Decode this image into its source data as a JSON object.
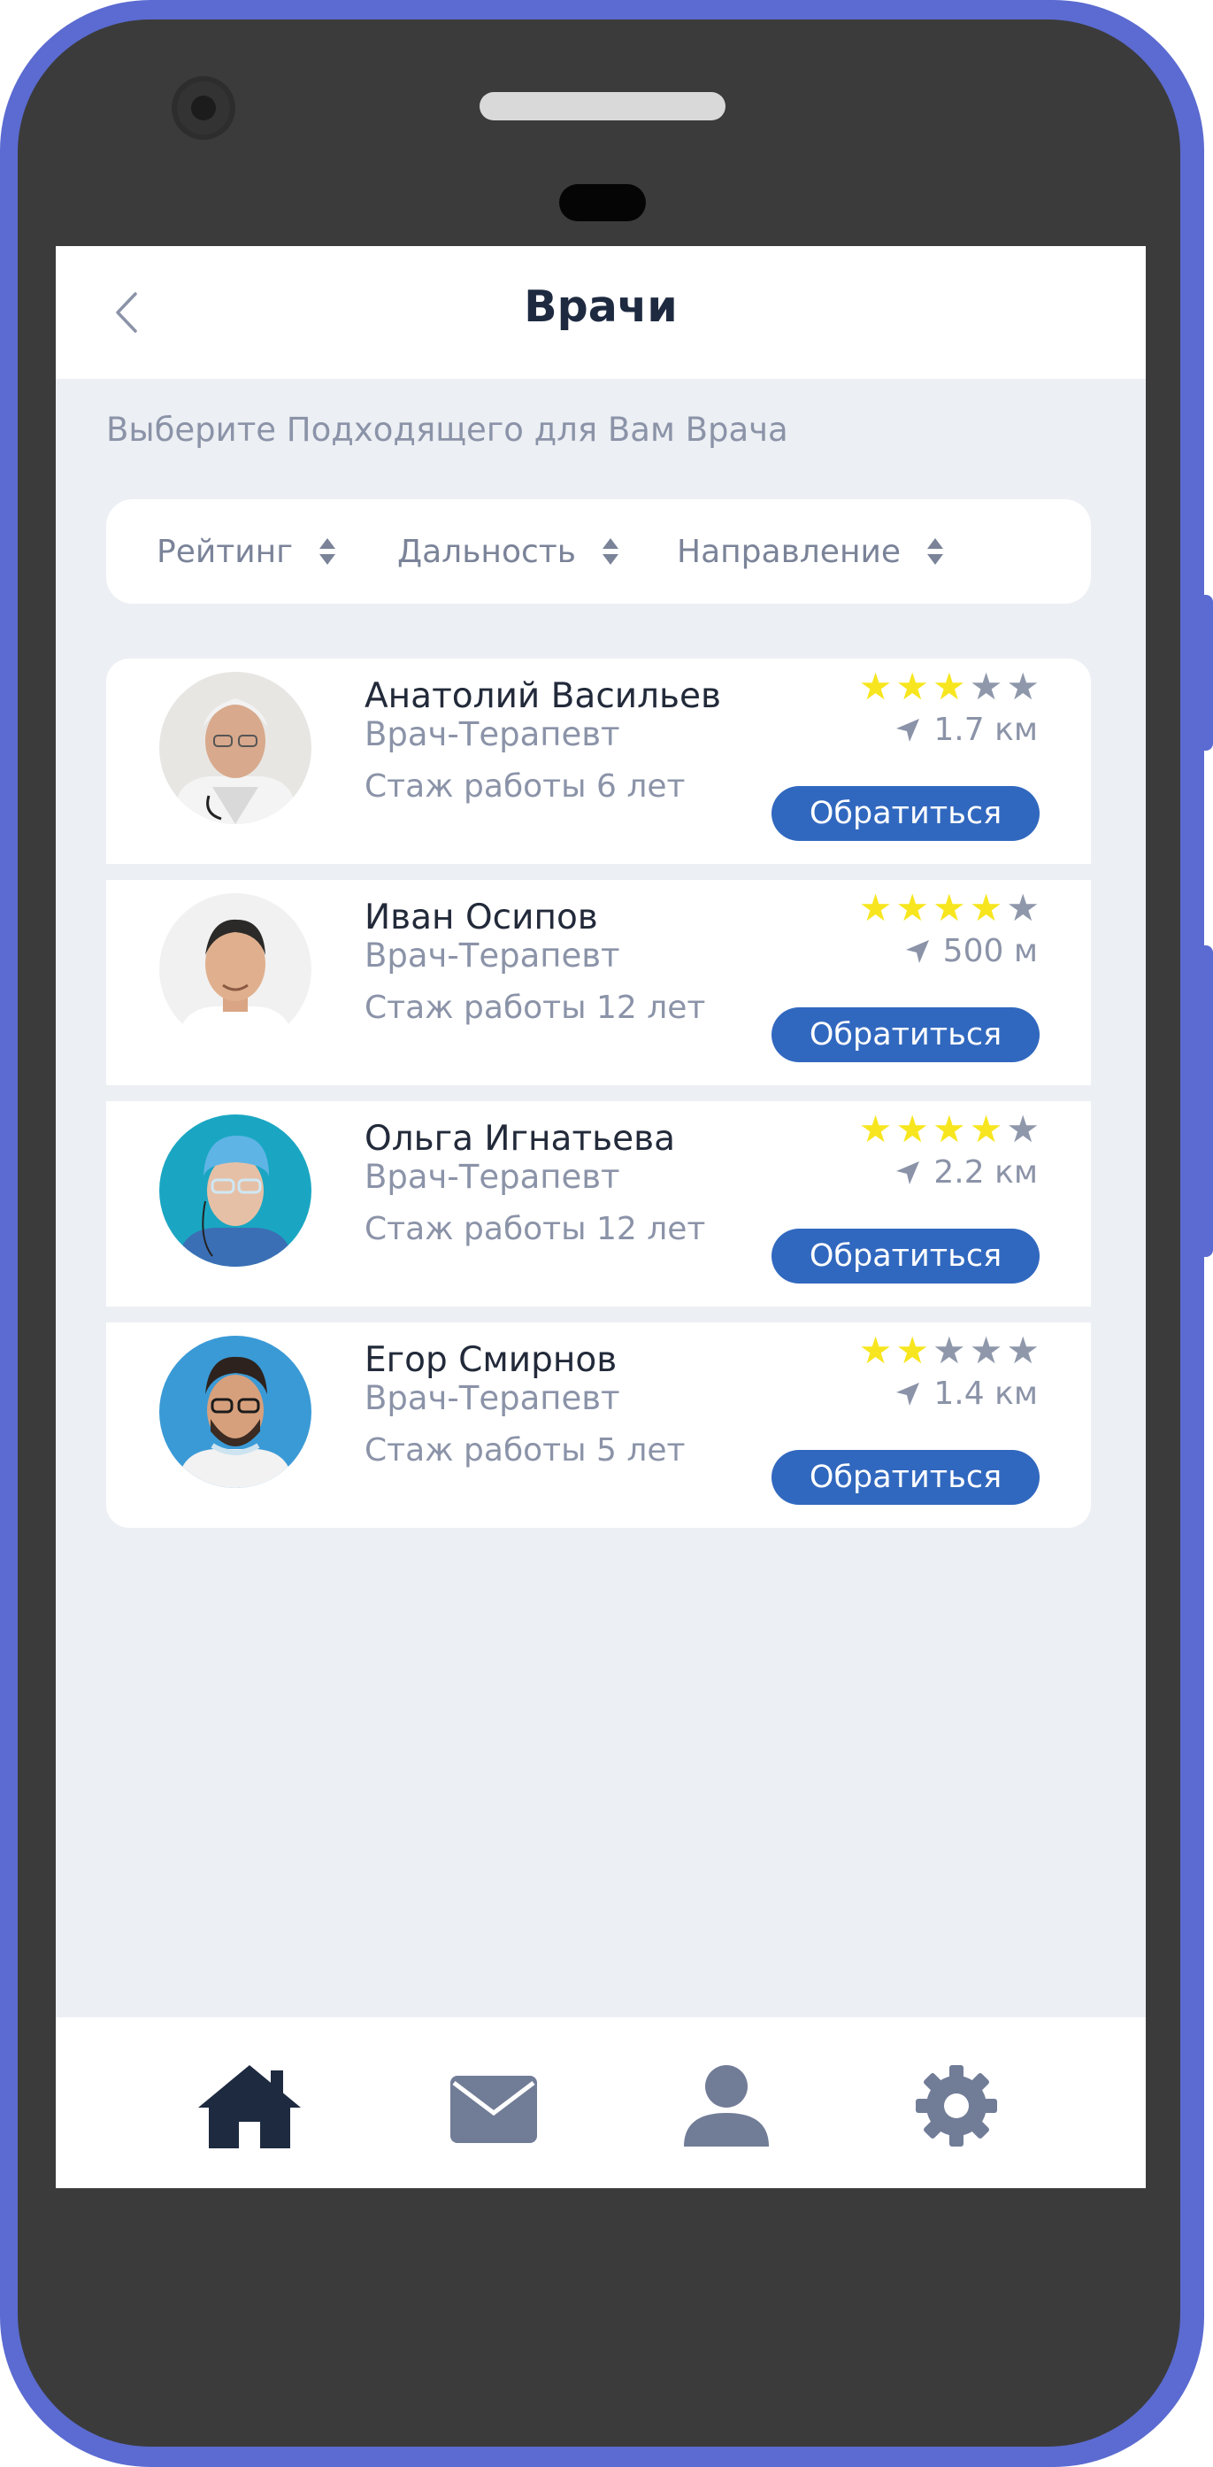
{
  "header": {
    "title": "Врачи"
  },
  "subtitle": "Выберите Подходящего для Вам Врача",
  "filters": [
    {
      "label": "Рейтинг"
    },
    {
      "label": "Дальность"
    },
    {
      "label": "Направление"
    }
  ],
  "doctors": [
    {
      "name": "Анатолий Васильев",
      "specialty": "Врач-Терапевт",
      "experience": "Стаж работы 6 лет",
      "rating": 3,
      "max_rating": 5,
      "distance": "1.7 км",
      "button": "Обратиться"
    },
    {
      "name": "Иван Осипов",
      "specialty": "Врач-Терапевт",
      "experience": "Стаж работы 12 лет",
      "rating": 4,
      "max_rating": 5,
      "distance": "500 м",
      "button": "Обратиться"
    },
    {
      "name": "Ольга Игнатьева",
      "specialty": "Врач-Терапевт",
      "experience": "Стаж работы 12 лет",
      "rating": 4,
      "max_rating": 5,
      "distance": "2.2 км",
      "button": "Обратиться"
    },
    {
      "name": "Егор Смирнов",
      "specialty": "Врач-Терапевт",
      "experience": "Стаж работы 5 лет",
      "rating": 2,
      "max_rating": 5,
      "distance": "1.4 км",
      "button": "Обратиться"
    }
  ],
  "bottom_nav": [
    {
      "icon": "home-icon",
      "active": true
    },
    {
      "icon": "mail-icon",
      "active": false
    },
    {
      "icon": "user-icon",
      "active": false
    },
    {
      "icon": "gear-icon",
      "active": false
    }
  ],
  "colors": {
    "accent": "#3168bf",
    "star_on": "#f7e61f",
    "star_off": "#8f98ab",
    "frame": "#5b6bd1",
    "nav_active": "#1e2a40",
    "nav_inactive": "#717c97"
  }
}
